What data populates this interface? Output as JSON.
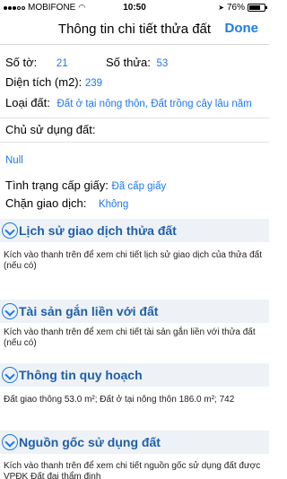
{
  "status": {
    "carrier": "MOBIFONE",
    "time": "10:50",
    "battery": "76%",
    "battery_level": 0.76
  },
  "nav": {
    "title": "Thông tin chi tiết thửa đất",
    "done_label": "Done"
  },
  "fields": {
    "so_to_label": "Số tờ:",
    "so_to_value": "21",
    "so_thua_label": "Số thửa:",
    "so_thua_value": "53",
    "dien_tich_label": "Diện tích (m2):",
    "dien_tich_value": "239",
    "loai_dat_label": "Loại đất:",
    "loai_dat_value": "Đất ở tại nông thôn, Đất trồng cây lâu năm",
    "chu_su_dung_label": "Chủ sử dụng đất:",
    "chu_su_dung_value": "Null",
    "tinh_trang_label": "Tình trạng cấp giấy:",
    "tinh_trang_value": "Đã cấp giấy",
    "chan_giao_dich_label": "Chặn giao dịch:",
    "chan_giao_dich_value": "Không"
  },
  "sections": [
    {
      "title": "Lịch sử giao dịch thửa đất",
      "body": "Kích vào thanh trên để xem chi tiết lịch sử giao dịch của thửa đất (nếu có)"
    },
    {
      "title": "Tài sản gắn liền với đất",
      "body": "Kích vào thanh trên để xem chi tiết tài sản gắn liền với thửa đất (nếu có)"
    },
    {
      "title": "Thông tin quy hoạch",
      "body": "Đất giao thông 53.0 m²; Đất ở tại nông thôn 186.0 m²; 742"
    },
    {
      "title": "Nguồn gốc sử dụng đất",
      "body": "Kích vào thanh trên để xem chi tiết nguồn gốc sử dụng đất được VPĐK Đất đai thẩm định"
    }
  ],
  "colors": {
    "accent": "#1f77ea",
    "section_bg": "#eef2f7",
    "section_title": "#1f5fa8"
  }
}
